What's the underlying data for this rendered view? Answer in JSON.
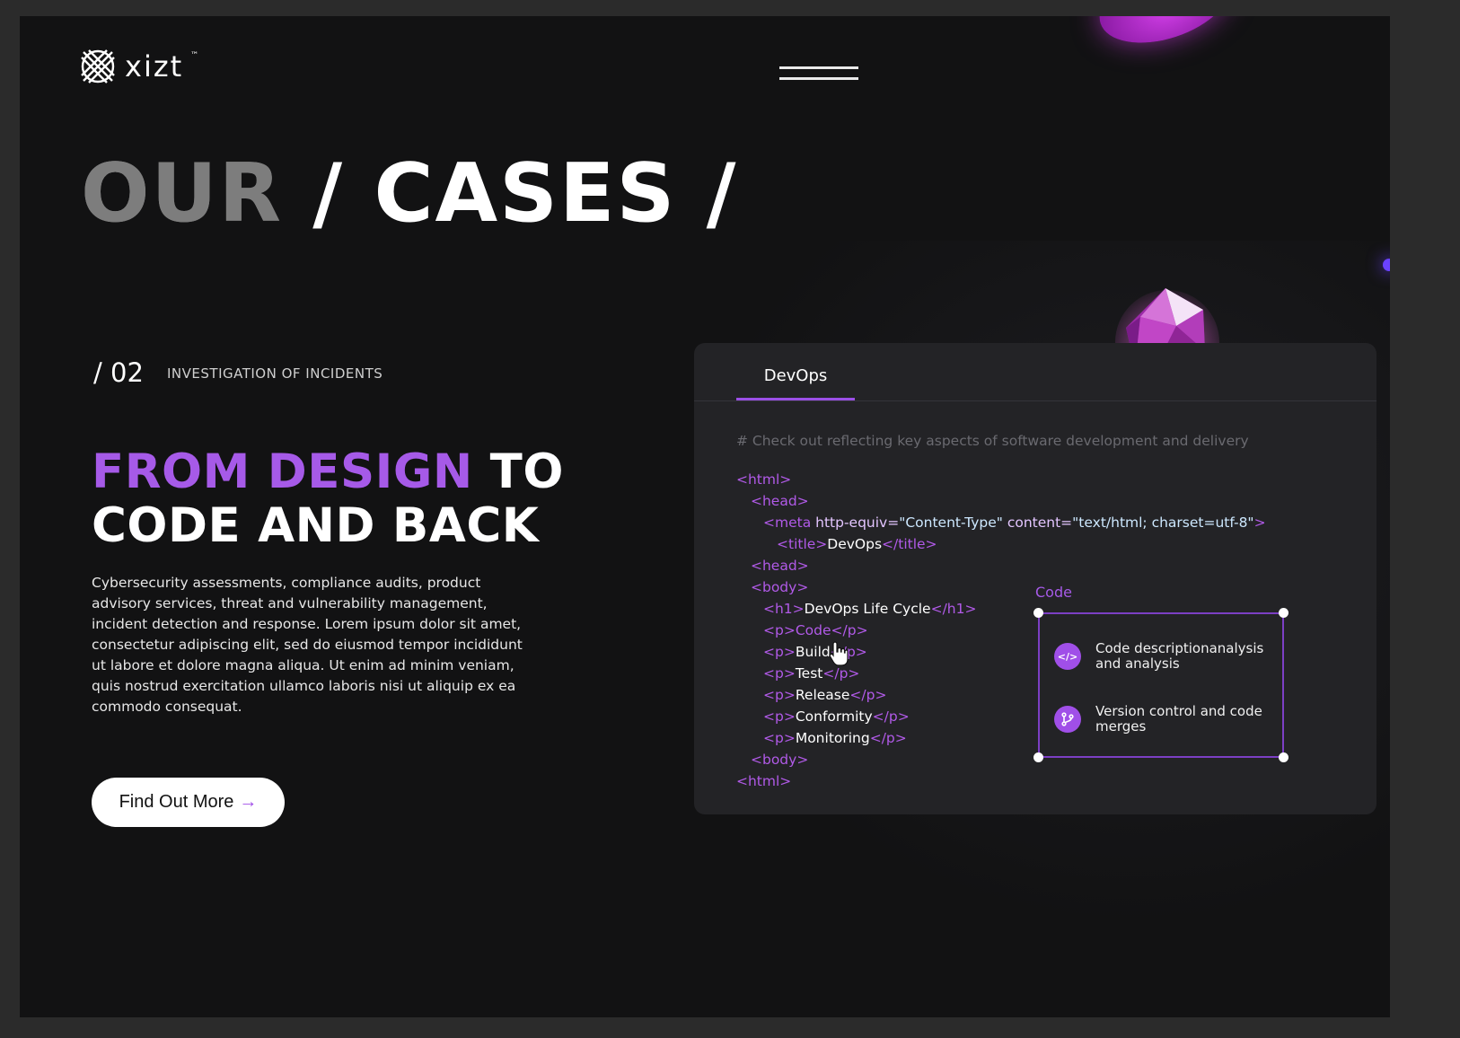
{
  "brand": {
    "name": "xizt",
    "tm": "™"
  },
  "hero": {
    "title_part1": "OUR",
    "title_part2": "/ CASES /"
  },
  "case": {
    "number": "/ 02",
    "label": "INVESTIGATION OF INCIDENTS"
  },
  "headline": {
    "accent": "FROM DESIGN",
    "line1_rest": " TO",
    "line2": "CODE AND BACK"
  },
  "description": "Cybersecurity assessments, compliance audits, product advisory services, threat and vulnerability management, incident detection and response. Lorem ipsum dolor sit amet, consectetur adipiscing elit, sed do eiusmod tempor incididunt ut labore et dolore magna aliqua. Ut enim ad minim veniam, quis nostrud exercitation ullamco laboris nisi ut aliquip ex ea commodo consequat.",
  "cta": {
    "label": "Find Out More",
    "arrow": "→"
  },
  "panel": {
    "tab": "DevOps",
    "comment": "# Check out reflecting key aspects of software development and delivery",
    "code": {
      "html_open": "<html>",
      "head_open": "<head>",
      "meta_open": "<meta",
      "meta_attr1": " http-equiv=",
      "meta_val1": "\"Content-Type\"",
      "meta_attr2": " content=",
      "meta_val2": "\"text/html; charset=utf-8\"",
      "meta_close": ">",
      "title_open": "<title>",
      "title_text": "DevOps",
      "title_close": "</title>",
      "head_close": "<head>",
      "body_open": "<body>",
      "h1_open": "<h1>",
      "h1_text": "DevOps Life Cycle",
      "h1_close": "</h1>",
      "p_open": "<p>",
      "p_close": "</p>",
      "items": [
        "Code",
        "Build",
        "Test",
        "Release",
        "Conformity",
        "Monitoring"
      ],
      "body_close": "<body>",
      "html_close": "<html>"
    },
    "selection": {
      "label": "Code",
      "items": [
        {
          "icon": "code-icon",
          "text": "Code descriptionanalysis and analysis"
        },
        {
          "icon": "git-branch-icon",
          "text": "Version control and code merges"
        }
      ]
    }
  },
  "colors": {
    "accent": "#a65ae8",
    "background": "#121213",
    "panel": "#232326"
  }
}
